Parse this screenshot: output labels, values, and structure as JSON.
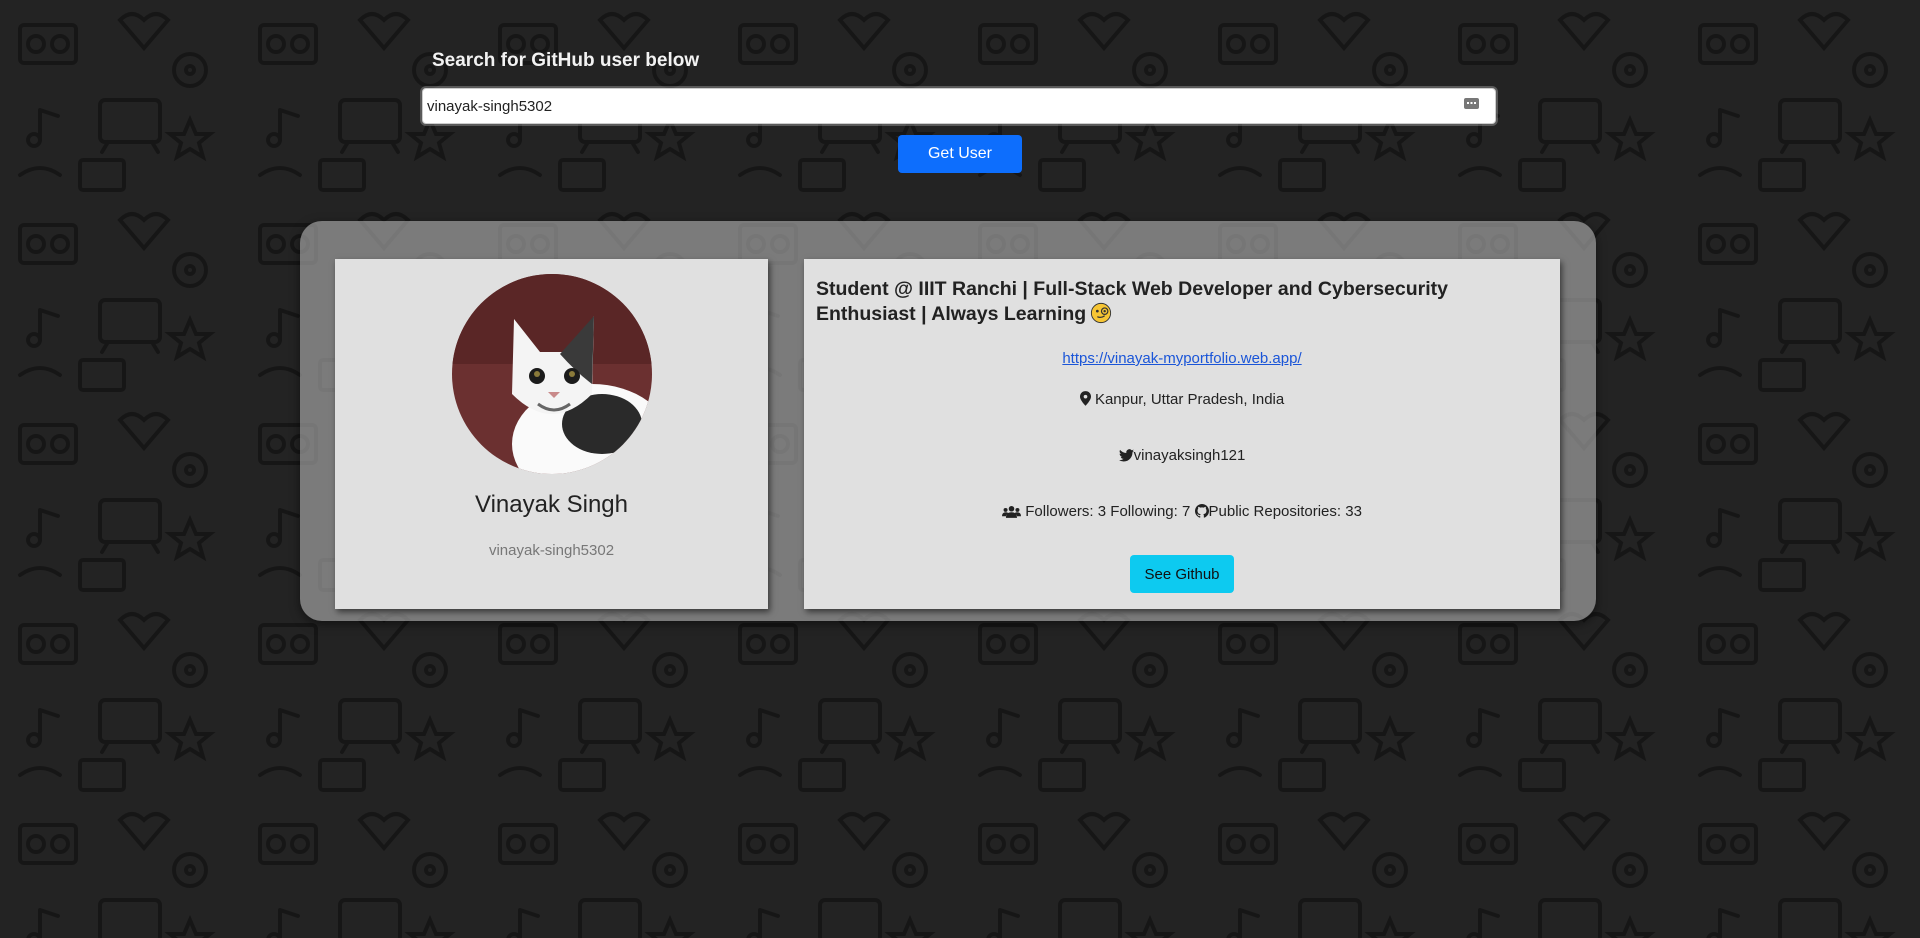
{
  "search": {
    "title": "Search for GitHub user below",
    "value": "vinayak-singh5302",
    "button_label": "Get User"
  },
  "profile": {
    "name": "Vinayak Singh",
    "login": "vinayak-singh5302",
    "avatar_icon": "cat-avatar-image"
  },
  "details": {
    "bio": "Student @ IIIT Ranchi | Full-Stack Web Developer and Cybersecurity Enthusiast | Always Learning",
    "website": "https://vinayak-myportfolio.web.app/",
    "location": "Kanpur, Uttar Pradesh, India",
    "twitter": "vinayaksingh121",
    "followers_text": "Followers: 3",
    "following_text": "Following: 7",
    "repos_text": "Public Repositories: 33",
    "see_github_label": "See Github"
  },
  "colors": {
    "primary": "#0d6efd",
    "info": "#0dcaf0",
    "link": "#1a55d8",
    "card": "#e0e0e0",
    "background": "#222222"
  }
}
